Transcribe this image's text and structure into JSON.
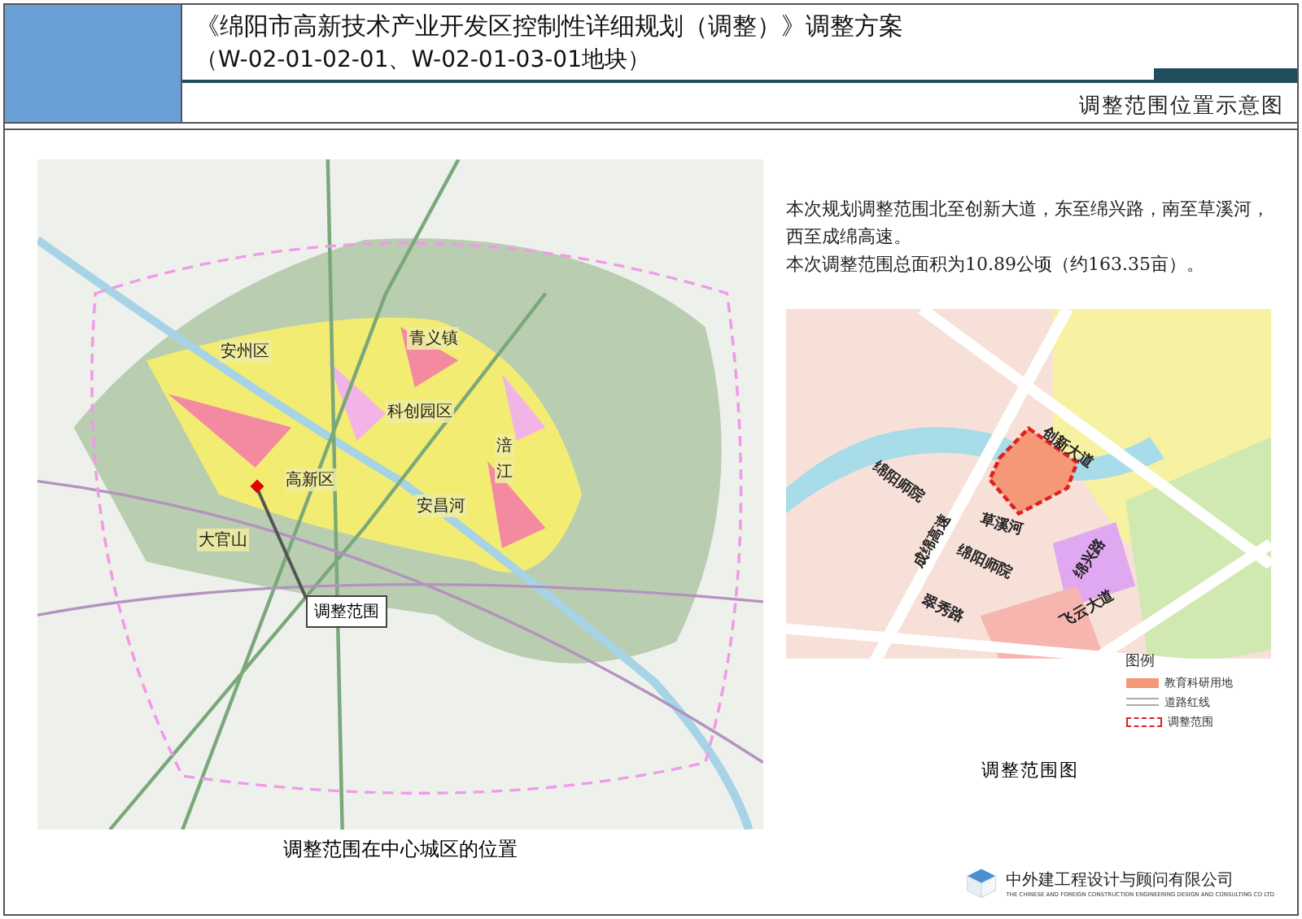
{
  "header": {
    "title_line_1": "《绵阳市高新技术产业开发区控制性详细规划（调整）》调整方案",
    "title_line_2": "（W-02-01-02-01、W-02-01-03-01地块）",
    "subtitle": "调整范围位置示意图"
  },
  "city_map": {
    "labels": [
      "安州区",
      "青义镇",
      "科创园区",
      "涪",
      "江",
      "高新区",
      "安昌河",
      "大官山"
    ],
    "callout": "调整范围",
    "caption": "调整范围在中心城区的位置"
  },
  "description": [
    "本次规划调整范围北至创新大道，东至绵兴路，南至草溪河，西至成绵高速。",
    "本次调整范围总面积为10.89公顷（约163.35亩）。"
  ],
  "site_map": {
    "labels": [
      "创新大道",
      "绵阳师院",
      "成绵高速",
      "草溪河",
      "绵阳师院",
      "绵兴路",
      "翠秀路",
      "飞云大道"
    ],
    "legend": {
      "title": "图例",
      "items": [
        {
          "kind": "fill",
          "label": "教育科研用地"
        },
        {
          "kind": "road",
          "label": "道路红线"
        },
        {
          "kind": "boundary",
          "label": "调整范围"
        }
      ]
    },
    "caption": "调整范围图"
  },
  "company": {
    "name": "中外建工程设计与顾问有限公司",
    "english": "THE CHINESE AND FOREIGN CONSTRUCTION ENGINEERING DESIGN AND CONSULTING CO LTD"
  }
}
